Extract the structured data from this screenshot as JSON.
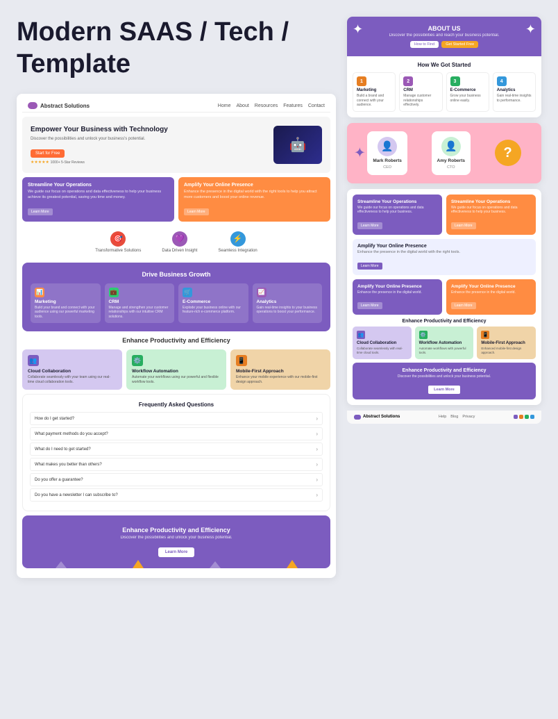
{
  "page": {
    "title": "Modern SAAS / Tech Template"
  },
  "left": {
    "title_line1": "Modern SAAS / Tech",
    "title_line2": "Template",
    "nav": {
      "brand": "Abstract Solutions",
      "links": [
        "Home",
        "About",
        "Resources",
        "Features",
        "Contact"
      ]
    },
    "hero": {
      "title": "Empower Your Business with Technology",
      "description": "Discover the possibilities and unlock your business's potential.",
      "cta_btn": "Start for Free",
      "reviews": "1000+ 5-Star Reviews",
      "stars": "★★★★★"
    },
    "feature_cards": [
      {
        "title": "Streamline Your Operations",
        "description": "We guide our focus on operations and data effectiveness to help your business achieve its greatest potential, saving you time and money.",
        "btn": "Learn More",
        "color": "purple"
      },
      {
        "title": "Amplify Your Online Presence",
        "description": "Enhance the presence in the digital world with the right tools to help you attract more customers and boost your online revenue.",
        "btn": "Learn More",
        "color": "orange"
      }
    ],
    "icons_row": [
      {
        "icon": "🎯",
        "label": "Transformative Solutions",
        "color": "red"
      },
      {
        "icon": "💜",
        "label": "Data Driven Insight",
        "color": "purple"
      },
      {
        "icon": "⚡",
        "label": "Seamless Integration",
        "color": "blue"
      }
    ],
    "drive_section": {
      "title": "Drive Business Growth",
      "cards": [
        {
          "icon": "📊",
          "name": "Marketing",
          "desc": "Build your brand and connect with your audience using our powerful marketing tools.",
          "color": "orange-bg"
        },
        {
          "icon": "💼",
          "name": "CRM",
          "desc": "Manage and strengthen your customer relationships with our intuitive CRM solutions.",
          "color": "green-bg"
        },
        {
          "icon": "🛒",
          "name": "E-Commerce",
          "desc": "Explode your business online with our feature-rich e-commerce platform.",
          "color": "blue-bg"
        },
        {
          "icon": "📈",
          "name": "Analytics",
          "desc": "Gain real-time insights to your business operations to boost your performance.",
          "color": "purple-bg"
        }
      ]
    },
    "enhance_section": {
      "title": "Enhance Productivity and Efficiency",
      "cards": [
        {
          "icon": "👥",
          "name": "Cloud Collaboration",
          "desc": "Collaborate seamlessly with your team using our real-time cloud collaboration tools.",
          "color": "purple-light"
        },
        {
          "icon": "⚙️",
          "name": "Workflow Automation",
          "desc": "Automate your workflows using our powerful and flexible workflow tools.",
          "color": "green-light"
        },
        {
          "icon": "📱",
          "name": "Mobile-First Approach",
          "desc": "Enhance your mobile experience with our mobile-first design approach.",
          "color": "orange-light"
        }
      ]
    },
    "faq": {
      "title": "Frequently Asked Questions",
      "items": [
        "How do I get started?",
        "What payment methods do you accept?",
        "What do I need to get started?",
        "What makes you better than others?",
        "Do you offer a guarantee?",
        "Do you have a newsletter I can subscribe to?"
      ]
    },
    "bottom_cta": {
      "title": "Enhance Productivity and Efficiency",
      "description": "Discover the possibilities and unlock your business potential.",
      "btn": "Learn More"
    }
  },
  "right": {
    "about_preview": {
      "title": "ABOUT US",
      "subtitle": "Discover the possibilities and reach your business potential.",
      "btn1": "How to Find",
      "btn2": "Get Started Free",
      "how_section": {
        "title": "How We Got Started",
        "cards": [
          {
            "num": "1",
            "title": "Marketing",
            "desc": "Build a brand and connect with your audience.",
            "color": "num-orange"
          },
          {
            "num": "2",
            "title": "CRM",
            "desc": "Manage customer relationships effectively.",
            "color": "num-purple"
          },
          {
            "num": "3",
            "title": "E-Commerce",
            "desc": "Grow your business online easily.",
            "color": "num-green"
          },
          {
            "num": "4",
            "title": "Analytics",
            "desc": "Gain real-time insights to performance.",
            "color": "num-blue"
          }
        ]
      }
    },
    "team_preview": {
      "person1": {
        "name": "Mark Roberts",
        "role": "CEO"
      },
      "person2": {
        "name": "Amy Roberts",
        "role": "CTO"
      }
    },
    "feature_grid": {
      "cards": [
        {
          "title": "Streamline Your Operations",
          "desc": "We guide our focus on operations and data effectiveness to help your business.",
          "btn": "Learn More",
          "color": "purple-rg"
        },
        {
          "title": "Streamline Your Operations",
          "desc": "We guide our focus on operations and data effectiveness to help your business.",
          "btn": "Learn More",
          "color": "orange-rg"
        }
      ],
      "full_card": {
        "title": "Amplify Your Online Presence",
        "desc": "Enhance the presence in the digital world with the right tools.",
        "btn": "Learn More"
      },
      "bottom_cards": [
        {
          "title": "Amplify Your Online Presence",
          "desc": "Enhance the presence in the digital world.",
          "btn": "Learn More",
          "color": "purple-rg"
        },
        {
          "title": "Amplify Your Online Presence",
          "desc": "Enhance the presence in the digital world.",
          "btn": "Learn More",
          "color": "orange-rg"
        }
      ]
    },
    "enhance": {
      "title": "Enhance Productivity and Efficiency",
      "cards": [
        {
          "icon": "👥",
          "name": "Cloud Collaboration",
          "desc": "Collaborate seamlessly with real-time cloud tools.",
          "color": "rec-purple"
        },
        {
          "icon": "⚙️",
          "name": "Workflow Automation",
          "desc": "Automate workflows with powerful tools.",
          "color": "rec-green"
        },
        {
          "icon": "📱",
          "name": "Mobile-First Approach",
          "desc": "Enhanced mobile-first design approach.",
          "color": "rec-orange"
        }
      ]
    },
    "bottom_cta": {
      "title": "Enhance Productivity and Efficiency",
      "desc": "Discover the possibilities and unlock your business potential.",
      "btn": "Learn More"
    },
    "footer": {
      "brand": "Abstract Solutions",
      "links": [
        "Help",
        "Blog",
        "Privacy"
      ],
      "dot_colors": [
        "#7c5cbf",
        "#e67e22",
        "#27ae60",
        "#3498db"
      ]
    }
  }
}
